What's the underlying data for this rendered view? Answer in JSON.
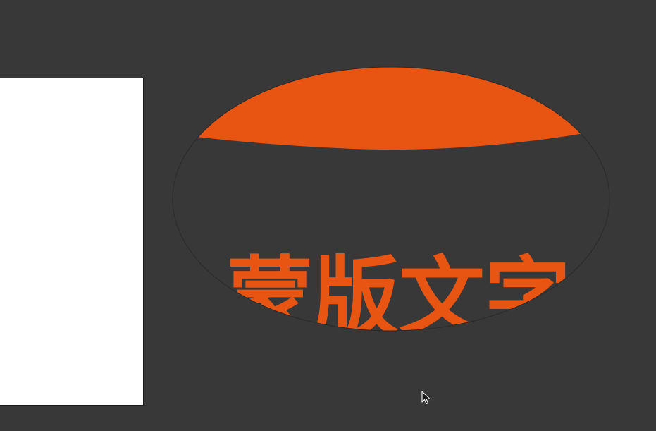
{
  "canvas": {
    "background_color": "#383838",
    "artboard_color": "#ffffff"
  },
  "mask_group": {
    "masked_text": "蒙版文字",
    "fill_color": "#e85512",
    "outline_color": "#2a2a2a"
  },
  "cursor": {
    "icon": "arrow-cursor-icon"
  }
}
